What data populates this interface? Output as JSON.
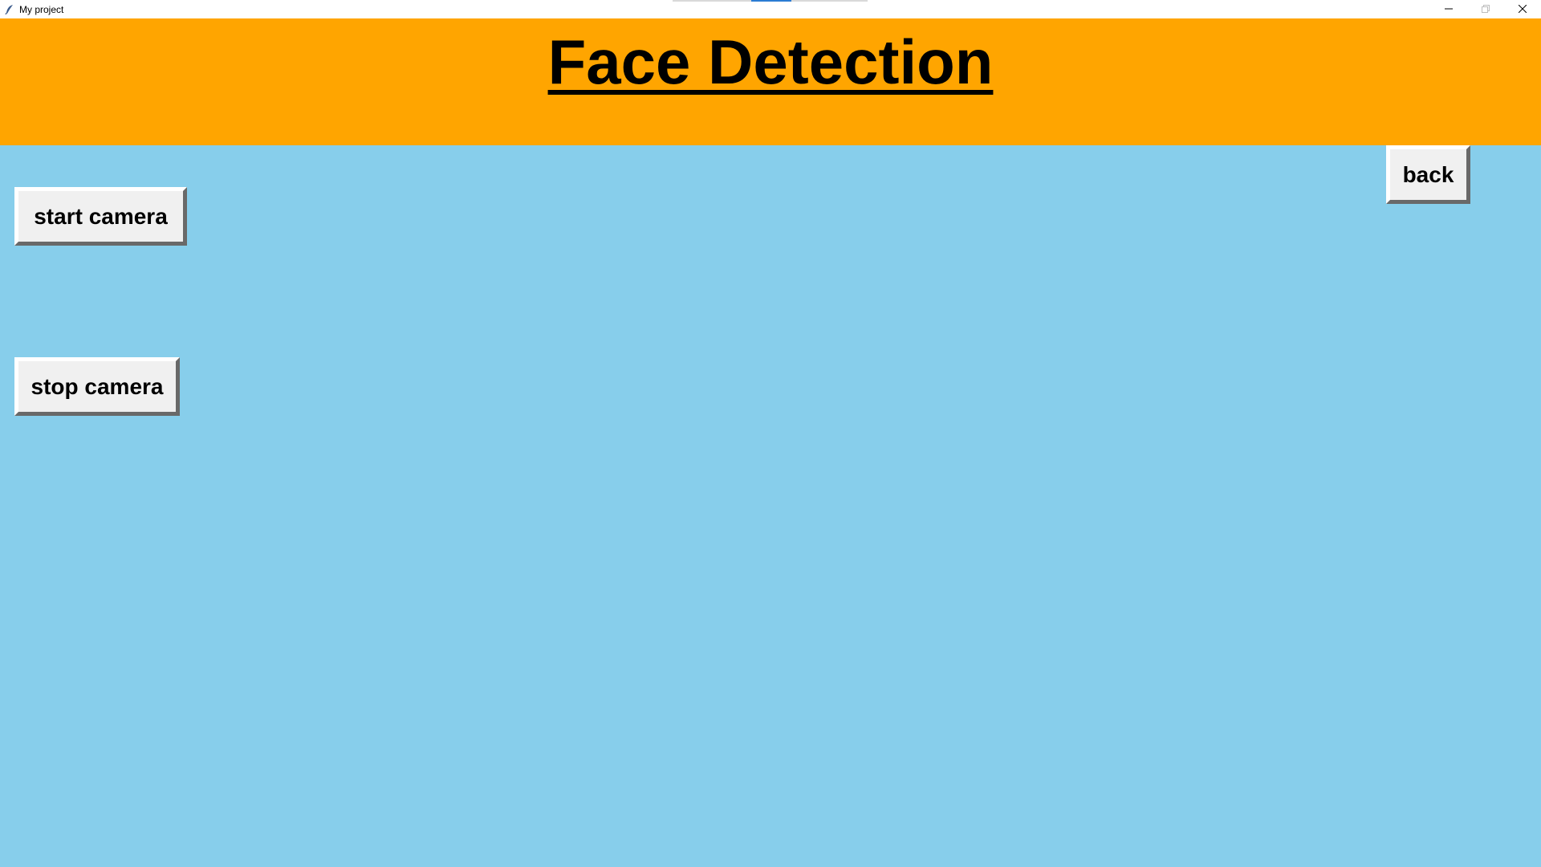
{
  "window": {
    "title": "My project",
    "app_icon": "feather-icon",
    "controls": {
      "minimize_icon": "minimize-icon",
      "maximize_icon": "restore-icon",
      "close_icon": "close-icon"
    }
  },
  "header": {
    "title": "Face Detection",
    "background": "#FFA500"
  },
  "main": {
    "background": "#87CEEB"
  },
  "buttons": {
    "start_camera": "start camera",
    "stop_camera": "stop camera",
    "back": "back"
  }
}
